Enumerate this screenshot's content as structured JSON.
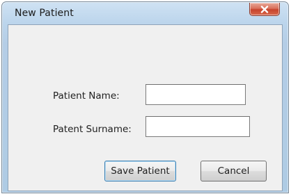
{
  "window": {
    "title": "New Patient"
  },
  "form": {
    "name_label": "Patient Name:",
    "name_value": "",
    "surname_label": "Patent Surname:",
    "surname_value": ""
  },
  "buttons": {
    "save_label": "Save Patient",
    "cancel_label": "Cancel"
  },
  "icons": {
    "close": "close-icon"
  }
}
